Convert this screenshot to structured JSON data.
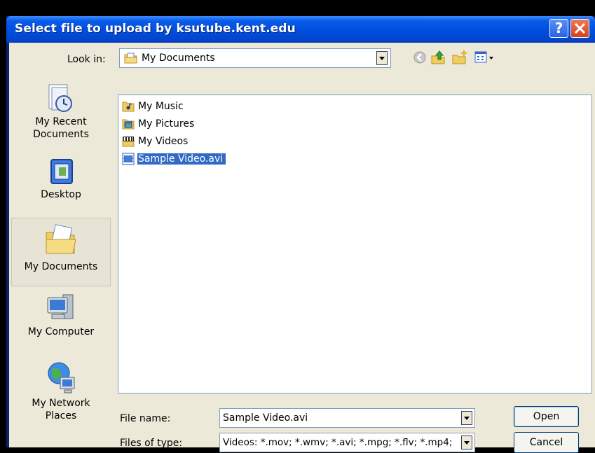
{
  "window": {
    "title": "Select file to upload by ksutube.kent.edu"
  },
  "titlebar": {
    "help_glyph": "?"
  },
  "lookin": {
    "label": "Look in:",
    "value": "My Documents",
    "icon": "my-documents-folder-icon"
  },
  "toolbar": {
    "icons": [
      "back-icon",
      "up-folder-icon",
      "new-folder-icon",
      "view-menu-icon"
    ]
  },
  "places": [
    {
      "label": "My Recent Documents",
      "icon": "recent-documents-icon",
      "selected": false
    },
    {
      "label": "Desktop",
      "icon": "desktop-icon",
      "selected": false
    },
    {
      "label": "My Documents",
      "icon": "my-documents-icon",
      "selected": true
    },
    {
      "label": "My Computer",
      "icon": "my-computer-icon",
      "selected": false
    },
    {
      "label": "My Network Places",
      "icon": "network-places-icon",
      "selected": false
    }
  ],
  "files": [
    {
      "name": "My Music",
      "icon": "music-folder-icon",
      "selected": false
    },
    {
      "name": "My Pictures",
      "icon": "pictures-folder-icon",
      "selected": false
    },
    {
      "name": "My Videos",
      "icon": "videos-folder-icon",
      "selected": false
    },
    {
      "name": "Sample Video.avi",
      "icon": "video-file-icon",
      "selected": true
    }
  ],
  "filename": {
    "label": "File name:",
    "value": "Sample Video.avi"
  },
  "filetype": {
    "label": "Files of type:",
    "value": "Videos: *.mov; *.wmv; *.avi; *.mpg; *.flv; *.mp4;"
  },
  "buttons": {
    "open": "Open",
    "cancel": "Cancel"
  },
  "colors": {
    "title_bar": "#0050e0",
    "selection": "#316ac5",
    "dialog_bg": "#ece9d8"
  }
}
